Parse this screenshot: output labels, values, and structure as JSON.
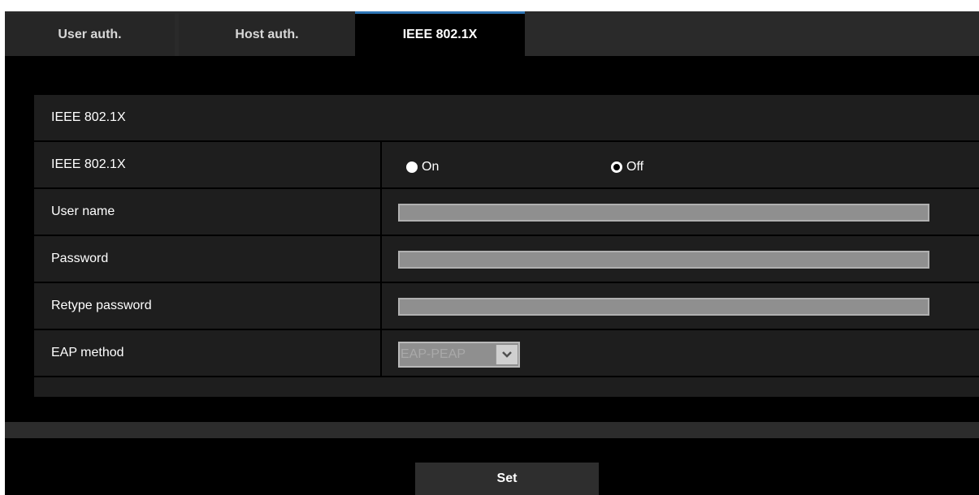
{
  "tabs": [
    {
      "label": "User auth.",
      "active": false
    },
    {
      "label": "Host auth.",
      "active": false
    },
    {
      "label": "IEEE 802.1X",
      "active": true
    }
  ],
  "section_title": "IEEE 802.1X",
  "fields": {
    "ieee": {
      "label": "IEEE 802.1X",
      "options": [
        "On",
        "Off"
      ],
      "selected": "Off"
    },
    "user_name": {
      "label": "User name",
      "value": ""
    },
    "password": {
      "label": "Password",
      "value": ""
    },
    "retype_password": {
      "label": "Retype password",
      "value": ""
    },
    "eap_method": {
      "label": "EAP method",
      "value": "EAP-PEAP"
    }
  },
  "set_button": "Set",
  "colors": {
    "accent": "#2e75b6",
    "background": "#000000",
    "panel": "#1e1e1e",
    "field": "#8f8f8f"
  }
}
